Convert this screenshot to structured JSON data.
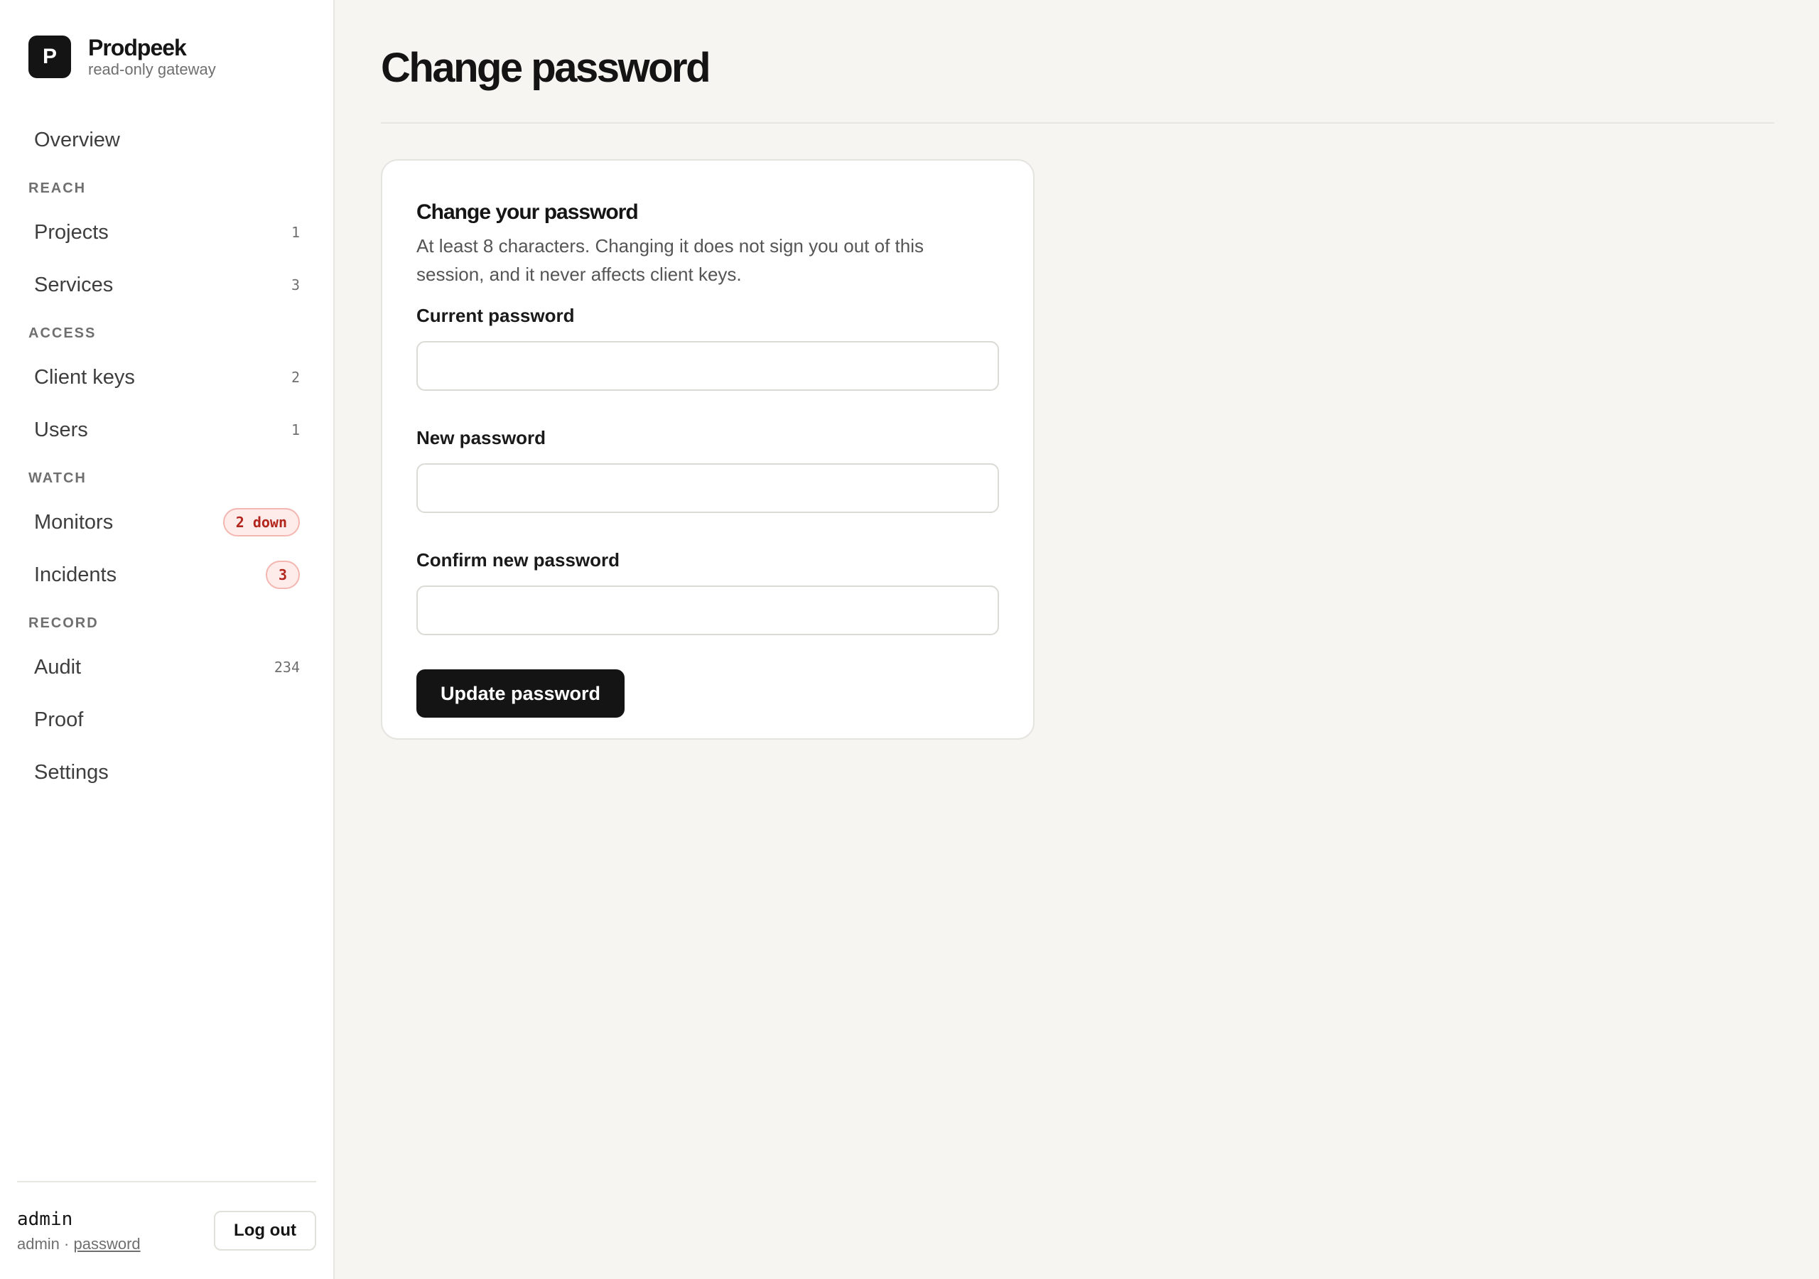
{
  "brand": {
    "logo_letter": "P",
    "name": "Prodpeek",
    "subtitle": "read-only gateway"
  },
  "nav": {
    "overview": {
      "label": "Overview"
    },
    "sections": {
      "reach": "REACH",
      "access": "ACCESS",
      "watch": "WATCH",
      "record": "RECORD"
    },
    "projects": {
      "label": "Projects",
      "count": "1"
    },
    "services": {
      "label": "Services",
      "count": "3"
    },
    "client_keys": {
      "label": "Client keys",
      "count": "2"
    },
    "users": {
      "label": "Users",
      "count": "1"
    },
    "monitors": {
      "label": "Monitors",
      "badge": "2 down"
    },
    "incidents": {
      "label": "Incidents",
      "badge": "3"
    },
    "audit": {
      "label": "Audit",
      "count": "234"
    },
    "proof": {
      "label": "Proof"
    },
    "settings": {
      "label": "Settings"
    }
  },
  "footer": {
    "username": "admin",
    "role": "admin",
    "separator": " · ",
    "password_link": "password",
    "logout_label": "Log out"
  },
  "page": {
    "title": "Change password"
  },
  "card": {
    "title": "Change your password",
    "description": "At least 8 characters. Changing it does not sign you out of this session, and it never affects client keys.",
    "current_label": "Current password",
    "current_value": "",
    "new_label": "New password",
    "new_value": "",
    "confirm_label": "Confirm new password",
    "confirm_value": "",
    "submit_label": "Update password"
  },
  "colors": {
    "accent": "#141414",
    "danger": "#b3261e",
    "danger_bg": "#fdecea",
    "background": "#f6f5f2"
  },
  "icons": {
    "logo": "letter-p-logo"
  }
}
